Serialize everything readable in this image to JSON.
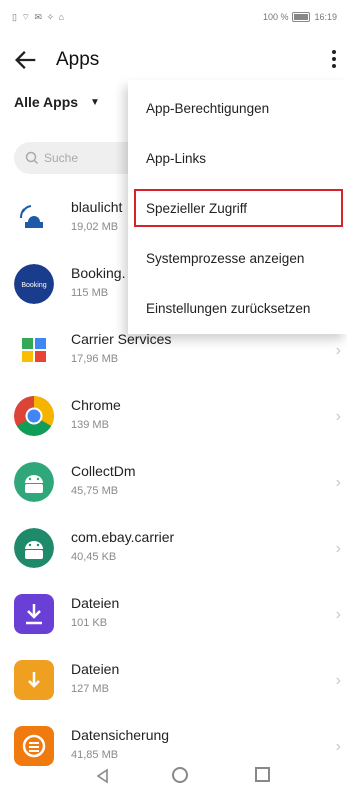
{
  "status": {
    "left_icons": "▯ ⌔ ✉ ✧ ⌂",
    "battery_text": "100 %",
    "time": "16:19"
  },
  "appbar": {
    "title": "Apps",
    "back_icon": "arrow-left-icon",
    "more_icon": "more-vert-icon"
  },
  "filter": {
    "label": "Alle Apps"
  },
  "search": {
    "placeholder": "Suche"
  },
  "apps": [
    {
      "name": "blaulicht",
      "size": "19,02 MB",
      "icon": "blaulicht-app-icon",
      "color": "#1e5aa8"
    },
    {
      "name": "Booking.",
      "size": "115 MB",
      "icon": "booking-app-icon",
      "color": "#1a3c8c",
      "icon_text": "Booking"
    },
    {
      "name": "Carrier Services",
      "size": "17,96 MB",
      "icon": "carrier-services-icon"
    },
    {
      "name": "Chrome",
      "size": "139 MB",
      "icon": "chrome-icon"
    },
    {
      "name": "CollectDm",
      "size": "45,75 MB",
      "icon": "android-icon",
      "color": "#2fa77a"
    },
    {
      "name": "com.ebay.carrier",
      "size": "40,45 KB",
      "icon": "android-icon",
      "color": "#1f8a6a"
    },
    {
      "name": "Dateien",
      "size": "101 KB",
      "icon": "download-folder-icon",
      "color": "#6a3fd6"
    },
    {
      "name": "Dateien",
      "size": "127 MB",
      "icon": "files-icon",
      "color": "#f0a020"
    },
    {
      "name": "Datensicherung",
      "size": "41,85 MB",
      "icon": "backup-icon",
      "color": "#f07a10"
    }
  ],
  "menu": {
    "items": [
      {
        "label": "App-Berechtigungen"
      },
      {
        "label": "App-Links"
      },
      {
        "label": "Spezieller Zugriff",
        "highlighted": true
      },
      {
        "label": "Systemprozesse anzeigen"
      },
      {
        "label": "Einstellungen zurücksetzen"
      }
    ],
    "highlight_color": "#d6222a"
  }
}
